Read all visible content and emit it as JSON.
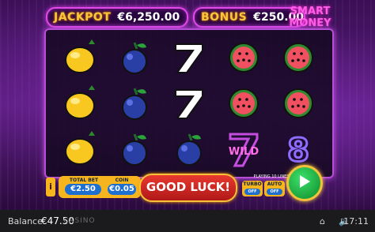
{
  "header": {
    "jackpot_label": "JACKPOT",
    "jackpot_value": "€6,250.00",
    "bonus_label": "BONUS",
    "bonus_value": "€250.00",
    "smart_money_line1": "SMART",
    "smart_money_line2": "MONEY"
  },
  "reels": [
    [
      "lemon",
      "plum",
      "seven",
      "watermelon",
      "watermelon"
    ],
    [
      "lemon",
      "plum",
      "seven",
      "watermelon",
      "watermelon"
    ],
    [
      "lemon",
      "plum",
      "plum",
      "wild",
      "eight"
    ]
  ],
  "symbols": {
    "wild_text": "WILD",
    "eight_text": "8"
  },
  "controls": {
    "info_label": "i",
    "total_bet_label": "TOTAL BET",
    "total_bet_value": "€2.50",
    "coin_label": "COIN",
    "coin_value": "€0.05",
    "main_message": "GOOD LUCK!",
    "lines_label": "PLAYING 10 LINES",
    "turbo_label": "TURBO",
    "turbo_state": "OFF",
    "auto_label": "AUTO",
    "auto_state": "OFF"
  },
  "status": {
    "balance_label": "Balance",
    "balance_value": "€47.50",
    "brand": "CASINO",
    "time": "17:11"
  },
  "colors": {
    "accent": "#e048e8",
    "gold": "#f6b51e",
    "spin_green": "#1fb846",
    "good_luck_red": "#d42a24"
  }
}
